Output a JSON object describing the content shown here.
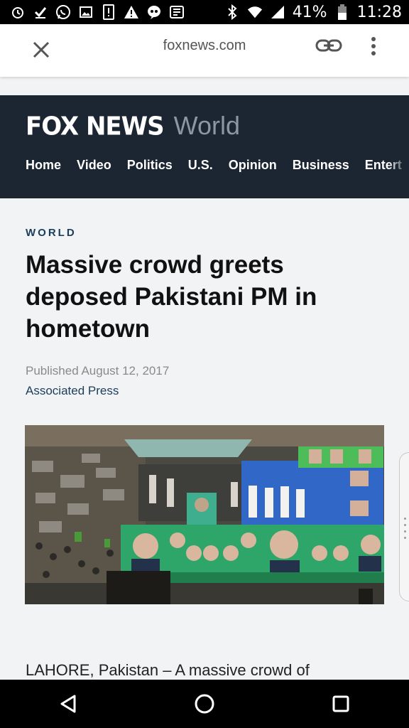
{
  "status_bar": {
    "battery": "41%",
    "time": "11:28",
    "left_icons": [
      "alarm-icon",
      "checkmark-icon",
      "whatsapp-icon",
      "gallery-icon",
      "sim-alert-icon",
      "warning-icon",
      "hangouts-icon",
      "news-icon"
    ],
    "right_icons": [
      "bluetooth-icon",
      "wifi-icon",
      "signal-icon",
      "battery-icon"
    ]
  },
  "browser": {
    "url": "foxnews.com",
    "icons": [
      "close-icon",
      "link-icon",
      "more-vert-icon"
    ]
  },
  "header": {
    "brand": "FOX NEWS",
    "section": "World",
    "nav": [
      "Home",
      "Video",
      "Politics",
      "U.S.",
      "Opinion",
      "Business",
      "Entert"
    ],
    "bg_color": "#1b2632"
  },
  "article": {
    "kicker": "WORLD",
    "headline": "Massive crowd greets deposed Pakistani PM in hometown",
    "published": "Published August 12, 2017",
    "author": "Associated Press",
    "body_start": "LAHORE, Pakistan –  A massive crowd of"
  },
  "navbar": {
    "icons": [
      "back-icon",
      "home-icon",
      "recents-icon"
    ]
  }
}
